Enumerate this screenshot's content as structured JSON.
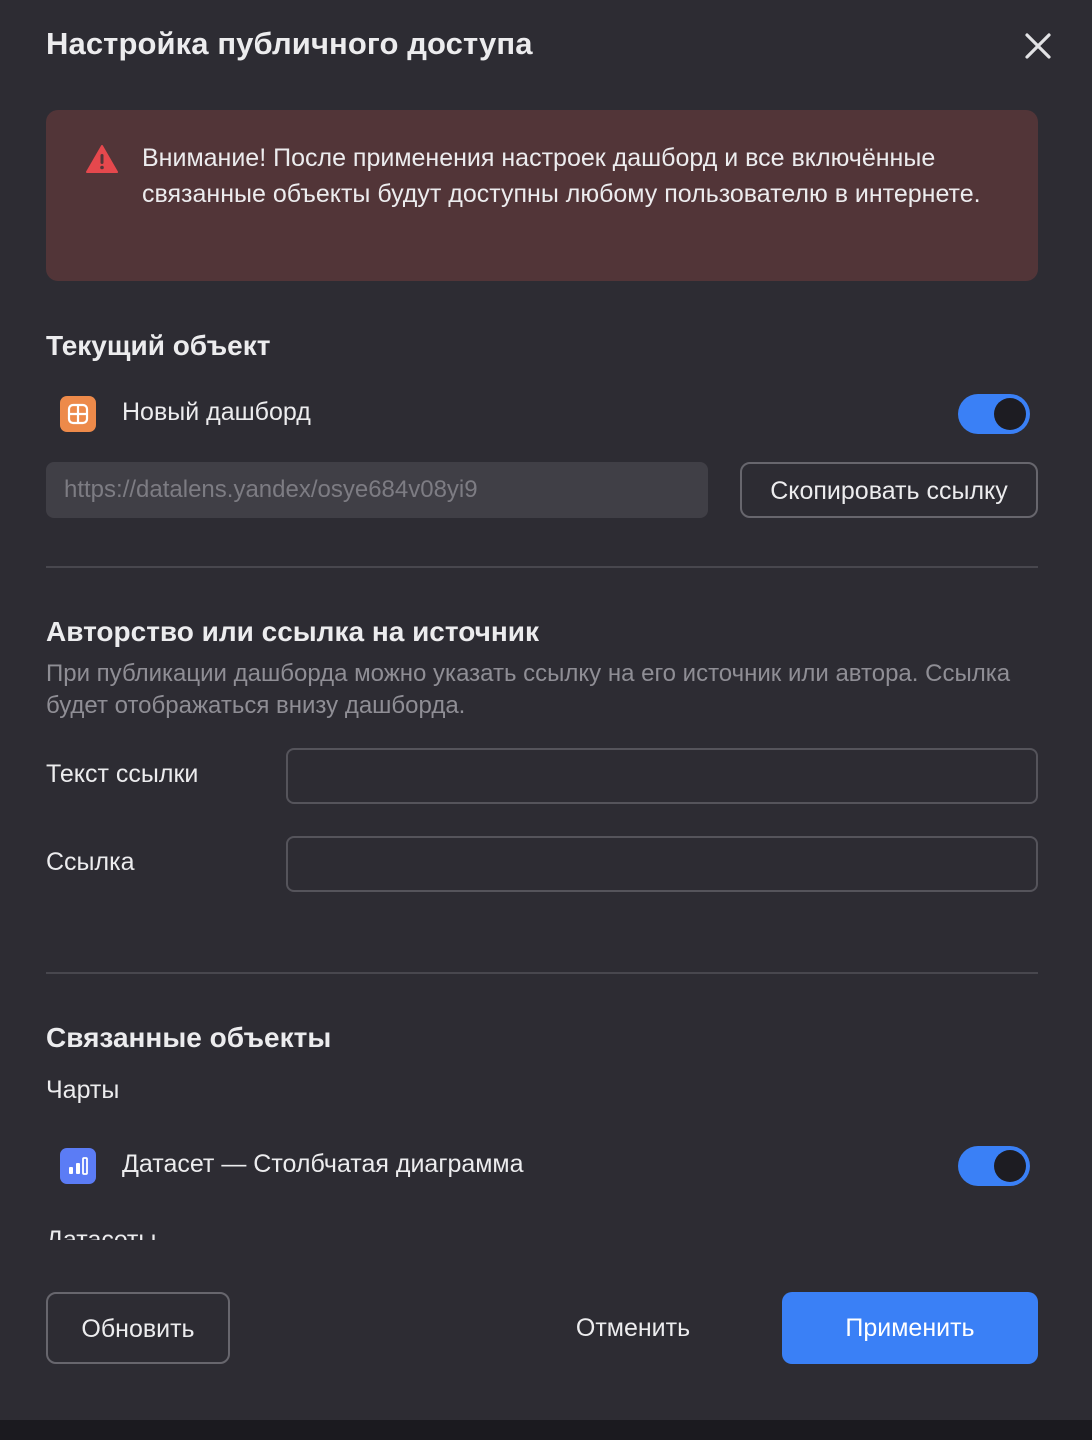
{
  "dialog": {
    "title": "Настройка публичного доступа",
    "close_icon": "close-icon"
  },
  "warning": {
    "icon": "warning-triangle-icon",
    "text": "Внимание! После применения настроек дашборд и все включённые связанные объекты будут доступны любому пользователю в интернете."
  },
  "current_object": {
    "heading": "Текущий объект",
    "item": {
      "icon": "dashboard-icon",
      "label": "Новый дашборд",
      "enabled": true
    },
    "url": "https://datalens.yandex/osye684v08yi9",
    "copy_button": "Скопировать ссылку"
  },
  "authorship": {
    "heading": "Авторство или ссылка на источник",
    "description": "При публикации дашборда можно указать ссылку на его источник или автора. Ссылка будет отображаться внизу дашборда.",
    "link_text_label": "Текст ссылки",
    "link_text_value": "",
    "link_label": "Ссылка",
    "link_value": ""
  },
  "related": {
    "heading": "Связанные объекты",
    "charts_label": "Чарты",
    "chart_item": {
      "icon": "bar-chart-icon",
      "label": "Датасет — Столбчатая диаграмма",
      "enabled": true
    },
    "datasets_label": "Датасеты"
  },
  "footer": {
    "refresh_button": "Обновить",
    "cancel_button": "Отменить",
    "apply_button": "Применить"
  },
  "colors": {
    "background": "#2d2c33",
    "warning_bg": "#523538",
    "accent": "#3a80f6",
    "dashboard_icon": "#ed8a4a",
    "chart_icon": "#5b7cf5",
    "warning_icon": "#e5484d"
  }
}
